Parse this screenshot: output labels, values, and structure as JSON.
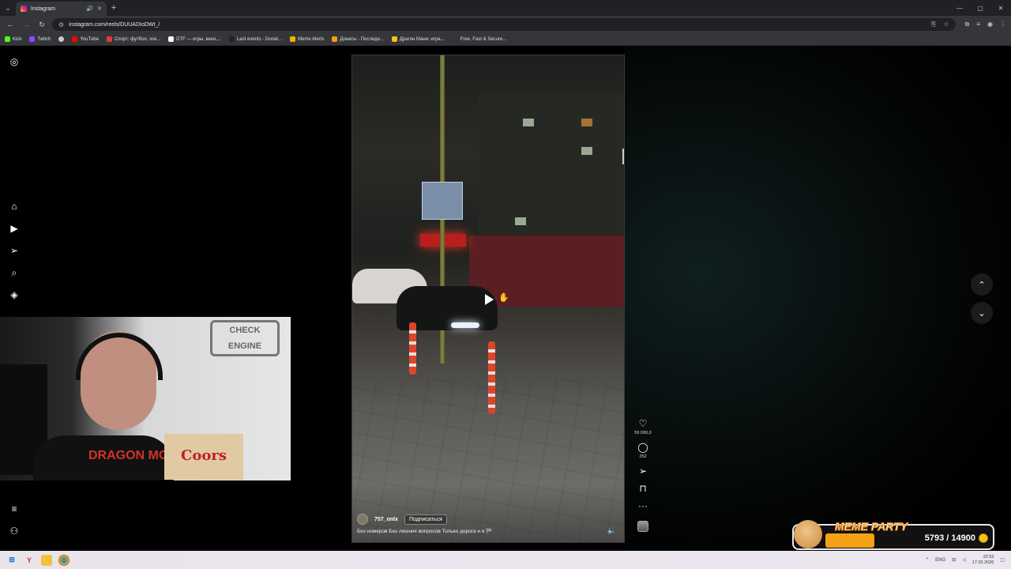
{
  "browser": {
    "tab_title": "Instagram",
    "url": "instagram.com/reels/DUUADIoDWt_/",
    "bookmarks": [
      {
        "label": "Kick",
        "color": "#53fc18"
      },
      {
        "label": "Twitch",
        "color": "#9146ff"
      },
      {
        "label": "",
        "color": "#cccccc"
      },
      {
        "label": "YouTube",
        "color": "#ff0000"
      },
      {
        "label": "Спорт: футбол, хок...",
        "color": "#e53935"
      },
      {
        "label": "DTF — игры, кино,...",
        "color": "#ffffff"
      },
      {
        "label": "Last events - Donat...",
        "color": "#222222"
      },
      {
        "label": "Meme Alerts",
        "color": "#f4b400"
      },
      {
        "label": "Донаты - Последн...",
        "color": "#f39c12"
      },
      {
        "label": "Драгон Мани: игра...",
        "color": "#f1c40f"
      },
      {
        "label": "Free, Fast & Secure...",
        "color": "#333333"
      }
    ]
  },
  "reel": {
    "author": "757_onlx",
    "follow_label": "Подписаться",
    "caption": "Без номеров Без лишних вопросов Только дорога и я 🏁",
    "likes": "59 000,0",
    "comments": "252"
  },
  "webcam": {
    "sign_text": "CHECK ENGINE",
    "shirt_text": "DRAGON MONEY",
    "box_text": "Coors"
  },
  "widget": {
    "title": "MEME PARTY",
    "progress": "5793 / 14900",
    "progress_fraction": 0.389
  },
  "taskbar": {
    "lang": "ENG",
    "time": "22:53",
    "date": "17.02.2026"
  }
}
